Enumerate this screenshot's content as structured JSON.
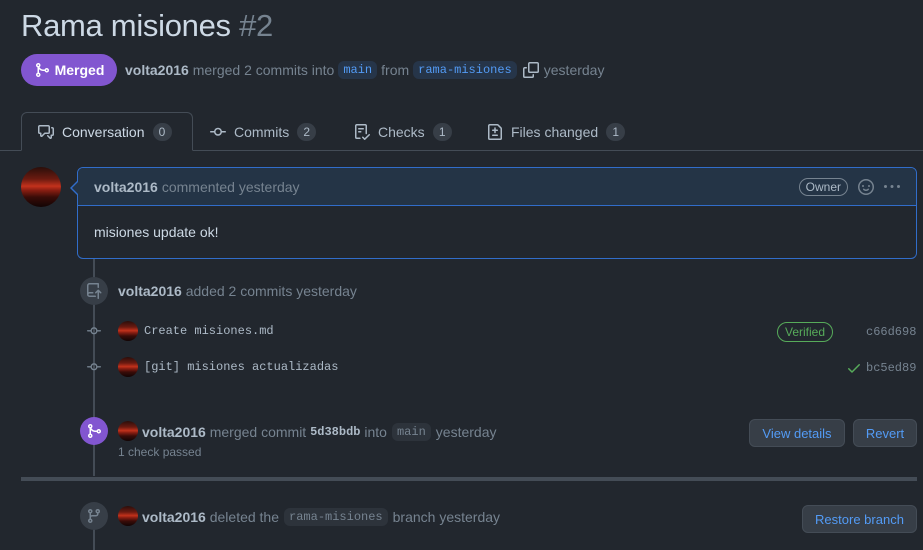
{
  "pr": {
    "title": "Rama misiones",
    "number": "#2",
    "state": "Merged",
    "author": "volta2016",
    "merge_text": "merged 2 commits into",
    "base_branch": "main",
    "from_text": "from",
    "head_branch": "rama-misiones",
    "time": "yesterday"
  },
  "tabs": [
    {
      "label": "Conversation",
      "count": "0"
    },
    {
      "label": "Commits",
      "count": "2"
    },
    {
      "label": "Checks",
      "count": "1"
    },
    {
      "label": "Files changed",
      "count": "1"
    }
  ],
  "comment": {
    "author": "volta2016",
    "action": "commented yesterday",
    "role": "Owner",
    "body": "misiones update ok!"
  },
  "commits_event": {
    "author": "volta2016",
    "text": "added 2 commits yesterday",
    "commits": [
      {
        "message": "Create misiones.md",
        "badge": "Verified",
        "sha": "c66d698"
      },
      {
        "message": "[git] misiones actualizadas",
        "sha": "bc5ed89"
      }
    ]
  },
  "merge_event": {
    "author": "volta2016",
    "text1": "merged commit",
    "sha": "5d38bdb",
    "text2": "into",
    "branch": "main",
    "time": "yesterday",
    "checks": "1 check passed",
    "view_details": "View details",
    "revert": "Revert"
  },
  "delete_event": {
    "author": "volta2016",
    "text1": "deleted the",
    "branch": "rama-misiones",
    "text2": "branch yesterday",
    "restore": "Restore branch"
  },
  "colors": {
    "accent": "#539bf5",
    "merged": "#8256d0",
    "verified": "#57ab5a",
    "background": "#22272e"
  }
}
